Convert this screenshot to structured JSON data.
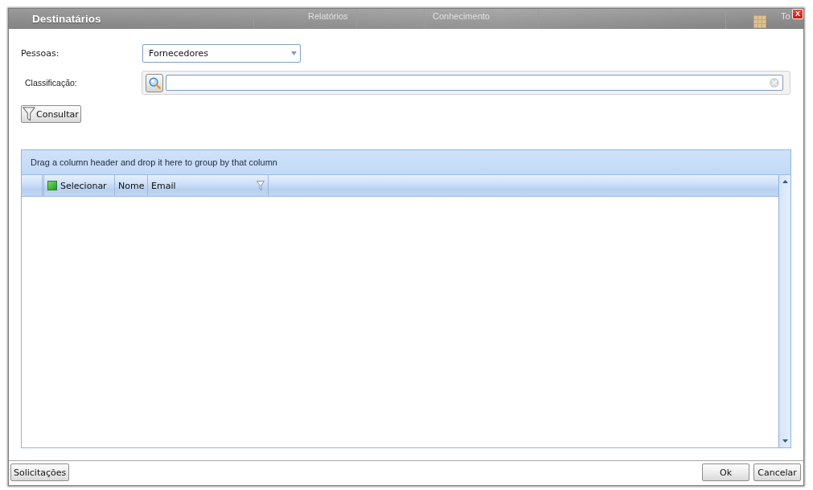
{
  "background_app": {
    "tabs": [
      {
        "label": "Relatórios"
      },
      {
        "label": "Conhecimento"
      },
      {
        "label": "To"
      }
    ]
  },
  "window": {
    "title": "Destinatários",
    "close_label": "X"
  },
  "form": {
    "fields": [
      {
        "kind": "select",
        "label": "Pessoas:",
        "value": "Fornecedores"
      },
      {
        "kind": "lookup",
        "label": "Classificação:"
      }
    ]
  },
  "query_button": {
    "label": "Consultar"
  },
  "grid": {
    "group_panel_text": "Drag a column header and drop it here to group by that column",
    "columns": [
      {
        "kind": "select",
        "label": "Selecionar"
      },
      {
        "kind": "text",
        "label": "Nome"
      },
      {
        "kind": "filter",
        "label": "Email"
      }
    ]
  },
  "footer": {
    "left_buttons": [
      "Solicitações"
    ],
    "right_buttons": [
      "Ok",
      "Cancelar"
    ]
  }
}
